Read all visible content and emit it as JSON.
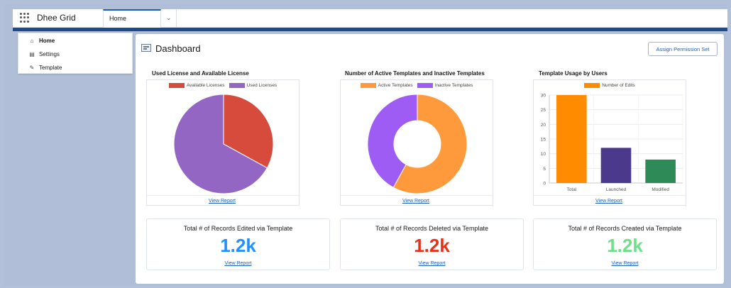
{
  "app": {
    "name": "Dhee Grid",
    "tab_label": "Home"
  },
  "sidebar": {
    "items": [
      {
        "label": "Home",
        "icon": "home-icon",
        "active": true
      },
      {
        "label": "Settings",
        "icon": "settings-icon",
        "active": false
      },
      {
        "label": "Template",
        "icon": "template-icon",
        "active": false
      }
    ]
  },
  "header": {
    "title": "Dashboard",
    "assign_button": "Assign Permission Set"
  },
  "cards": {
    "license": {
      "title": "Used License and Available License",
      "view_report": "View Report"
    },
    "templates": {
      "title": "Number of Active Templates and Inactive Templates",
      "view_report": "View Report"
    },
    "usage": {
      "title": "Template Usage by Users",
      "view_report": "View Report"
    }
  },
  "stats": [
    {
      "label": "Total # of Records Edited via Template",
      "value": "1.2k",
      "color": "#1e90ff",
      "link": "View Report"
    },
    {
      "label": "Total # of Records Deleted via Template",
      "value": "1.2k",
      "color": "#e8301b",
      "link": "View Report"
    },
    {
      "label": "Total # of Records Created via Template",
      "value": "1.2k",
      "color": "#6ee08a",
      "link": "View Report"
    }
  ],
  "chart_data": [
    {
      "type": "pie",
      "title": "Used License and Available License",
      "categories": [
        "Available Licenses",
        "Used Licenses"
      ],
      "values": [
        33,
        67
      ],
      "colors": [
        "#d64b3c",
        "#9266c2"
      ],
      "legend": "top"
    },
    {
      "type": "pie",
      "title": "Number of Active Templates and Inactive Templates",
      "categories": [
        "Active Templates",
        "Inactive Templates"
      ],
      "values": [
        58,
        42
      ],
      "colors": [
        "#ff9a3c",
        "#9f5cf5"
      ],
      "legend": "top"
    },
    {
      "type": "bar",
      "title": "Template Usage by Users",
      "categories": [
        "Total",
        "Launched",
        "Modified"
      ],
      "series": [
        {
          "name": "Number of Edits",
          "values": [
            30,
            12,
            8
          ]
        }
      ],
      "colors": [
        "#ff8c00",
        "#4b3a8c",
        "#2e8b57"
      ],
      "ylim": [
        0,
        30
      ],
      "yticks": [
        0,
        5,
        10,
        15,
        20,
        25,
        30
      ],
      "legend": "top",
      "grid": true
    }
  ]
}
